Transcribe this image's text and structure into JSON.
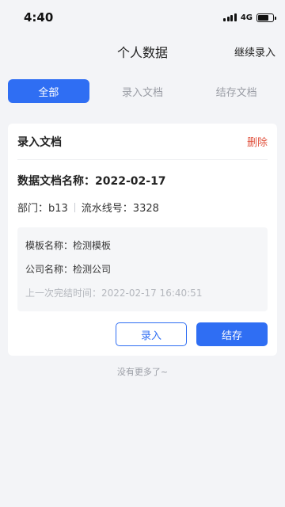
{
  "status_bar": {
    "time": "4:40",
    "network": "4G",
    "battery_level": 0.7
  },
  "header": {
    "title": "个人数据",
    "action_label": "继续录入"
  },
  "tabs": [
    {
      "label": "全部",
      "active": true
    },
    {
      "label": "录入文档",
      "active": false
    },
    {
      "label": "结存文档",
      "active": false
    }
  ],
  "card": {
    "title": "录入文档",
    "delete_label": "删除",
    "doc_name": "数据文档名称：2022-02-17",
    "department": "部门：b13",
    "serial": "流水线号：3328",
    "template": "模板名称：检测模板",
    "company": "公司名称：检测公司",
    "last_finish": "上一次完结时间：2022-02-17 16:40:51",
    "btn_entry": "录入",
    "btn_save": "结存"
  },
  "footer": {
    "no_more": "没有更多了~"
  },
  "colors": {
    "accent": "#2f6ef3",
    "danger": "#e0523e"
  }
}
